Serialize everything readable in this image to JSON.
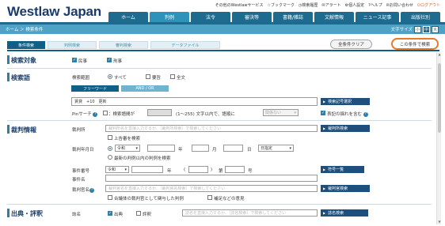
{
  "header": {
    "logo": "Westlaw Japan",
    "util": {
      "other_services": "その他のWestlawサービス",
      "bookmark": "ブックマーク",
      "history": "検索履歴",
      "alert": "アラート",
      "personal": "個人設定",
      "help": "ヘルプ",
      "contact": "お問い合わせ",
      "logout": "ログアウト"
    },
    "tabs": [
      "ホーム",
      "判例",
      "法令",
      "審決等",
      "書籍/雑誌",
      "文献情報",
      "ニュース記事",
      "出版社別"
    ],
    "active_tab": "判例"
  },
  "breadcrumb": "ホーム ＞ 検索条件",
  "font_size": {
    "label": "文字サイズ",
    "options": [
      "小",
      "中",
      "大"
    ],
    "selected": "中"
  },
  "subtabs": [
    "条件検索",
    "判例検索",
    "審判検索",
    "データファイル"
  ],
  "active_subtab": "条件検索",
  "actions": {
    "clear": "全条件クリア",
    "search": "この条件で検索"
  },
  "target": {
    "title": "検索対象",
    "options": [
      "民事",
      "刑事"
    ]
  },
  "keyword": {
    "title": "検索語",
    "scope_label": "検索範囲",
    "scope_options": [
      "すべて",
      "要旨",
      "全文"
    ],
    "modes": [
      "フリーワード",
      "AND / OR"
    ],
    "active_mode": "フリーワード",
    "value": "賃貸　+10　更新",
    "help_button": "検索記号選択",
    "pin_label": "Pinサーチ",
    "pin_text": "：検索語間が",
    "pin_range": "(1～255) 文字以内で、語順に",
    "pin_select": "関係ない",
    "synonym_label": "表記の揺れを含む"
  },
  "court": {
    "title": "裁判情報",
    "court_label": "裁判所",
    "court_placeholder": "裁判所名を直接入力するか、［裁判所検索］で検索してください",
    "court_button": "裁判所検索",
    "upper_court": "上告審を検索",
    "date_label": "裁判年月日",
    "date_era": "令和",
    "date_year": "年",
    "date_month": "月",
    "date_day": "日",
    "date_mode": "日指定",
    "latest": "最新の判例以内の判例を検索",
    "case_no_label": "事件番号",
    "case_no_era": "令和",
    "case_no_year": "年",
    "case_no_paren": "(",
    "case_no_close": ")",
    "case_no_dai": "第",
    "case_no_go": "号",
    "case_no_button": "符号一覧",
    "case_name_label": "事件名",
    "judge_label": "裁判官名",
    "judge_placeholder": "裁判官名を直接入力するか、［裁判官名検索］で検索してください",
    "judge_button": "裁判官検索",
    "opt1": "合議体の裁判官として関与した判例",
    "opt2": "補足などの意見"
  },
  "source": {
    "title": "出典・評釈",
    "label": "誌名",
    "opt1": "出典",
    "opt2": "評釈",
    "placeholder": "誌名を直接入力するか、［誌名検索］で検索してください",
    "button": "誌名検索"
  }
}
